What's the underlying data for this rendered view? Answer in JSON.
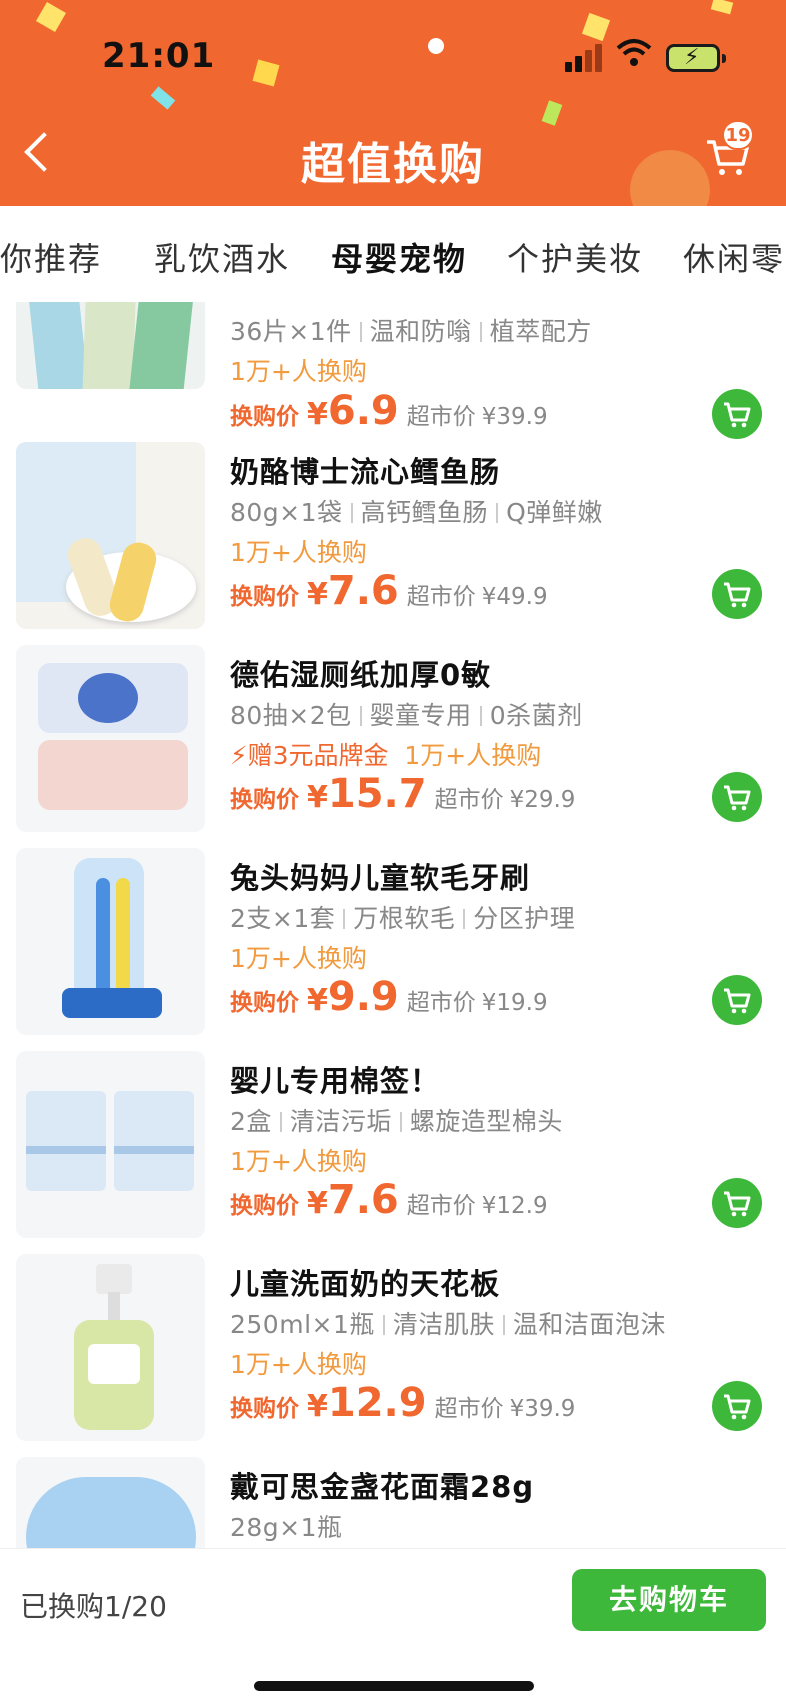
{
  "status": {
    "time": "21:01"
  },
  "header": {
    "title": "超值换购",
    "cart_count": "19"
  },
  "tabs": [
    "为你推荐",
    "乳饮酒水",
    "母婴宠物",
    "个护美妆",
    "休闲零食"
  ],
  "active_tab": 2,
  "items": [
    {
      "name": "",
      "spec": [
        "36片×1件",
        "温和防嗡",
        "植萃配方"
      ],
      "gift": "",
      "sold": "1万+人换购",
      "price_label": "换购价",
      "yen": "¥",
      "price": "6.9",
      "market_label": "超市价",
      "market_price": "¥39.9",
      "thumb": "baby-sticker-pack"
    },
    {
      "name": "奶酪博士流心鳕鱼肠",
      "spec": [
        "80g×1袋",
        "高钙鳕鱼肠",
        "Q弹鲜嫩"
      ],
      "gift": "",
      "sold": "1万+人换购",
      "price_label": "换购价",
      "yen": "¥",
      "price": "7.6",
      "market_label": "超市价",
      "market_price": "¥49.9",
      "thumb": "fish-sausage"
    },
    {
      "name": "德佑湿厕纸加厚0敏",
      "spec": [
        "80抽×2包",
        "婴童专用",
        "0杀菌剂"
      ],
      "gift": "赠3元品牌金",
      "sold": "1万+人换购",
      "price_label": "换购价",
      "yen": "¥",
      "price": "15.7",
      "market_label": "超市价",
      "market_price": "¥29.9",
      "thumb": "wet-toilet-paper"
    },
    {
      "name": "兔头妈妈儿童软毛牙刷",
      "spec": [
        "2支×1套",
        "万根软毛",
        "分区护理"
      ],
      "gift": "",
      "sold": "1万+人换购",
      "price_label": "换购价",
      "yen": "¥",
      "price": "9.9",
      "market_label": "超市价",
      "market_price": "¥19.9",
      "thumb": "kids-toothbrush"
    },
    {
      "name": "婴儿专用棉签！",
      "spec": [
        "2盒",
        "清洁污垢",
        "螺旋造型棉头"
      ],
      "gift": "",
      "sold": "1万+人换购",
      "price_label": "换购价",
      "yen": "¥",
      "price": "7.6",
      "market_label": "超市价",
      "market_price": "¥12.9",
      "thumb": "cotton-swabs"
    },
    {
      "name": "儿童洗面奶的天花板",
      "spec": [
        "250ml×1瓶",
        "清洁肌肤",
        "温和洁面泡沫"
      ],
      "gift": "",
      "sold": "1万+人换购",
      "price_label": "换购价",
      "yen": "¥",
      "price": "12.9",
      "market_label": "超市价",
      "market_price": "¥39.9",
      "thumb": "kids-cleanser"
    },
    {
      "name": "戴可思金盏花面霜28g",
      "spec": [
        "28g×1瓶"
      ],
      "gift": "",
      "sold": "",
      "price_label": "",
      "yen": "",
      "price": "",
      "market_label": "",
      "market_price": "",
      "thumb": "face-cream"
    }
  ],
  "bottom": {
    "exchanged": "已换购1/20",
    "go_cart": "去购物车"
  },
  "colors": {
    "brand": "#f0672f",
    "cart_green": "#3db83a",
    "sold_text": "#f29a3e"
  }
}
